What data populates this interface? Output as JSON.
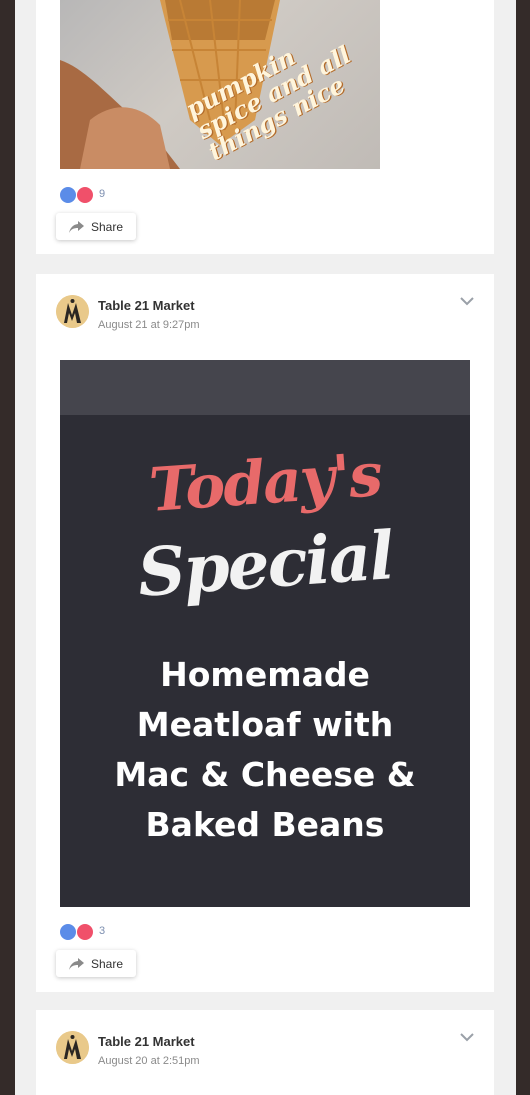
{
  "posts": [
    {
      "image_text": "pumpkin spice and all things nice",
      "reaction_count": "9",
      "share_label": "Share"
    },
    {
      "page_name": "Table 21 Market",
      "date": "August 21 at 9:27pm",
      "image": {
        "title_line1": "Today's",
        "title_line2": "Special",
        "description": "Homemade\nMeatloaf with\nMac & Cheese &\nBaked Beans"
      },
      "reaction_count": "3",
      "share_label": "Share"
    },
    {
      "page_name": "Table 21 Market",
      "date": "August 20 at 2:51pm"
    }
  ],
  "colors": {
    "page_bg": "#342b29",
    "feed_bg": "#f0f0f0",
    "like": "#5b8ce8",
    "love": "#f0506a",
    "special_red": "#e86a6a"
  },
  "icons": [
    "like-icon",
    "love-icon",
    "share-arrow-icon",
    "chevron-down-icon",
    "avatar-logo"
  ]
}
